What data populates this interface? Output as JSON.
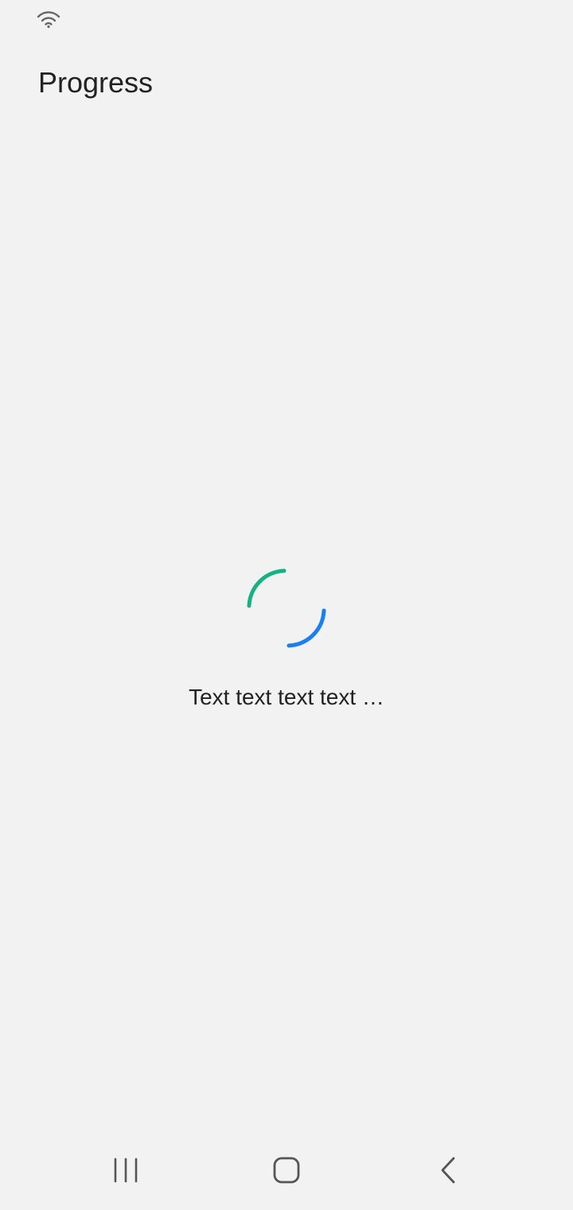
{
  "status_bar": {
    "icons": [
      "wifi-icon"
    ]
  },
  "header": {
    "title": "Progress"
  },
  "progress": {
    "message": "Text text text text …",
    "indicator": "indeterminate-spinner",
    "colors": {
      "arc_primary": "#16b285",
      "arc_secondary": "#1a7ff0"
    }
  },
  "navigation_bar": {
    "buttons": [
      "recents-icon",
      "home-icon",
      "back-icon"
    ],
    "icon_color": "#555555"
  },
  "theme": {
    "background": "#f2f2f2",
    "text": "#222222"
  }
}
